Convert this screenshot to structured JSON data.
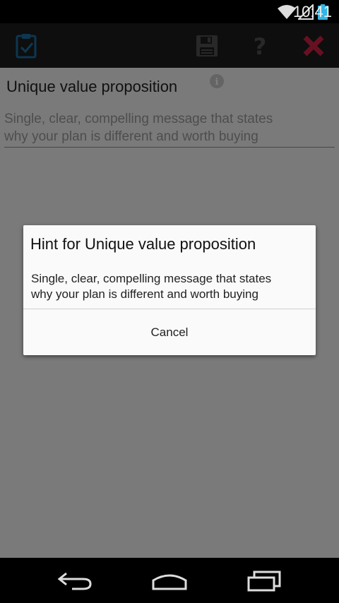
{
  "status_bar": {
    "time": "10:41",
    "icons": [
      "wifi-icon",
      "signal-icon",
      "battery-icon"
    ]
  },
  "action_bar": {
    "icons": [
      "clipboard-check-icon",
      "save-icon",
      "help-icon",
      "close-icon"
    ],
    "help_glyph": "?"
  },
  "form": {
    "field_label": "Unique value proposition",
    "info_glyph": "i",
    "field_placeholder_line1": "Single, clear, compelling message that states",
    "field_placeholder_line2": "why your plan is different and worth buying"
  },
  "dialog": {
    "title": "Hint for Unique value proposition",
    "message_line1": "Single, clear, compelling message that states",
    "message_line2": "why your plan is different and worth buying",
    "cancel_label": "Cancel"
  },
  "nav_bar": {
    "icons": [
      "back-icon",
      "home-icon",
      "recent-apps-icon"
    ]
  },
  "colors": {
    "accent_blue": "#33b5e5",
    "close_red": "#cc2244",
    "scrim": "rgba(0,0,0,0.5)"
  }
}
